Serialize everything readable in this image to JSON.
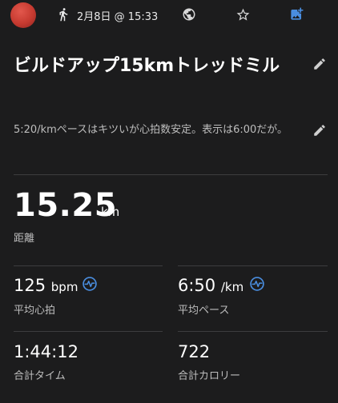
{
  "header": {
    "date_time": "2月8日 @ 15:33",
    "icons": [
      "avatar",
      "run-icon",
      "globe-icon",
      "star-icon",
      "add-photo-icon"
    ],
    "accent_color": "#4a8ee0"
  },
  "activity": {
    "title": "ビルドアップ15kmトレッドミル",
    "description": "5:20/kmペースはキツいが心拍数安定。表示は6:00だが。"
  },
  "distance": {
    "value": "15.25",
    "unit": "km",
    "label": "距離"
  },
  "stats": {
    "heart_rate": {
      "value": "125",
      "unit": "bpm",
      "label": "平均心拍"
    },
    "pace": {
      "value": "6:50",
      "unit": "/km",
      "label": "平均ペース"
    },
    "time": {
      "value": "1:44:12",
      "label": "合計タイム"
    },
    "calories": {
      "value": "722",
      "label": "合計カロリー"
    }
  }
}
